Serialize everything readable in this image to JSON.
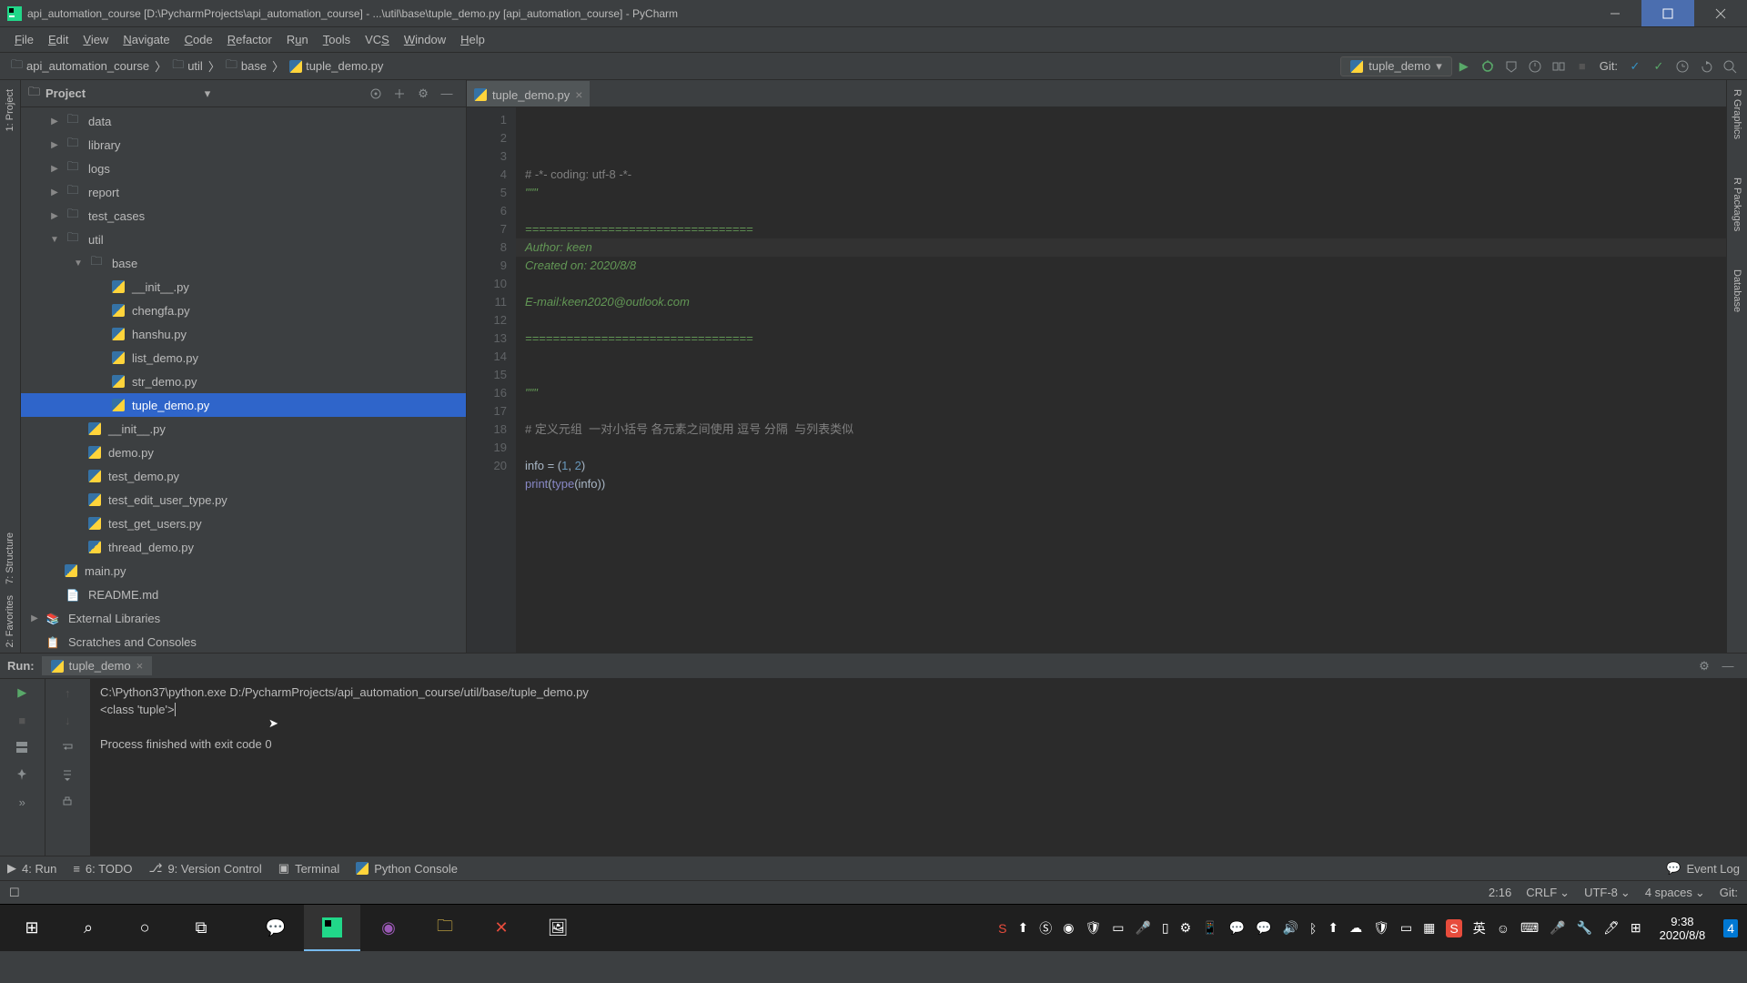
{
  "window": {
    "title": "api_automation_course [D:\\PycharmProjects\\api_automation_course] - ...\\util\\base\\tuple_demo.py [api_automation_course] - PyCharm"
  },
  "menu": [
    "File",
    "Edit",
    "View",
    "Navigate",
    "Code",
    "Refactor",
    "Run",
    "Tools",
    "VCS",
    "Window",
    "Help"
  ],
  "breadcrumbs": [
    "api_automation_course",
    "util",
    "base",
    "tuple_demo.py"
  ],
  "run_config": {
    "name": "tuple_demo"
  },
  "project_panel": {
    "title": "Project"
  },
  "tree": {
    "items": [
      {
        "label": "data",
        "indent": 1,
        "icon": "folder",
        "arrow": "right"
      },
      {
        "label": "library",
        "indent": 1,
        "icon": "folder",
        "arrow": "right"
      },
      {
        "label": "logs",
        "indent": 1,
        "icon": "folder",
        "arrow": "right"
      },
      {
        "label": "report",
        "indent": 1,
        "icon": "folder",
        "arrow": "right"
      },
      {
        "label": "test_cases",
        "indent": 1,
        "icon": "folder",
        "arrow": "right"
      },
      {
        "label": "util",
        "indent": 1,
        "icon": "folder",
        "arrow": "down"
      },
      {
        "label": "base",
        "indent": 2,
        "icon": "folder",
        "arrow": "down"
      },
      {
        "label": "__init__.py",
        "indent": 3,
        "icon": "py",
        "arrow": ""
      },
      {
        "label": "chengfa.py",
        "indent": 3,
        "icon": "py",
        "arrow": ""
      },
      {
        "label": "hanshu.py",
        "indent": 3,
        "icon": "py",
        "arrow": ""
      },
      {
        "label": "list_demo.py",
        "indent": 3,
        "icon": "py",
        "arrow": ""
      },
      {
        "label": "str_demo.py",
        "indent": 3,
        "icon": "py",
        "arrow": ""
      },
      {
        "label": "tuple_demo.py",
        "indent": 3,
        "icon": "py",
        "arrow": "",
        "selected": true
      },
      {
        "label": "__init__.py",
        "indent": 2,
        "icon": "py",
        "arrow": ""
      },
      {
        "label": "demo.py",
        "indent": 2,
        "icon": "py",
        "arrow": ""
      },
      {
        "label": "test_demo.py",
        "indent": 2,
        "icon": "py",
        "arrow": ""
      },
      {
        "label": "test_edit_user_type.py",
        "indent": 2,
        "icon": "py",
        "arrow": ""
      },
      {
        "label": "test_get_users.py",
        "indent": 2,
        "icon": "py",
        "arrow": ""
      },
      {
        "label": "thread_demo.py",
        "indent": 2,
        "icon": "py",
        "arrow": ""
      },
      {
        "label": "main.py",
        "indent": 1,
        "icon": "py",
        "arrow": ""
      },
      {
        "label": "README.md",
        "indent": 1,
        "icon": "md",
        "arrow": ""
      },
      {
        "label": "External Libraries",
        "indent": 0,
        "icon": "lib",
        "arrow": "right"
      },
      {
        "label": "Scratches and Consoles",
        "indent": 0,
        "icon": "scratch",
        "arrow": ""
      }
    ]
  },
  "editor": {
    "tab": "tuple_demo.py",
    "lines": 20,
    "code": {
      "l1": "# -*- coding: utf-8 -*-",
      "l2": "\"\"\"",
      "l3": "",
      "l4": "=================================",
      "l5": "Author: keen",
      "l6": "Created on: 2020/8/8",
      "l7": "",
      "l8": "E-mail:keen2020@outlook.com",
      "l9": "",
      "l10": "=================================",
      "l11": "",
      "l12": "",
      "l13": "\"\"\"",
      "l14": "",
      "l15": "# 定义元组  一对小括号 各元素之间使用 逗号 分隔  与列表类似",
      "l16": "",
      "l17_a": "info = (",
      "l17_b": "1",
      "l17_c": ", ",
      "l17_d": "2",
      "l17_e": ")",
      "l18_a": "print",
      "l18_b": "(",
      "l18_c": "type",
      "l18_d": "(info))"
    }
  },
  "run_panel": {
    "title": "Run:",
    "tab": "tuple_demo",
    "output_line1": "C:\\Python37\\python.exe D:/PycharmProjects/api_automation_course/util/base/tuple_demo.py",
    "output_line2": "<class 'tuple'>",
    "output_line3": "",
    "output_line4": "Process finished with exit code 0"
  },
  "bottom_tabs": {
    "run": "4: Run",
    "todo": "6: TODO",
    "vcs": "9: Version Control",
    "terminal": "Terminal",
    "console": "Python Console",
    "event": "Event Log"
  },
  "status": {
    "pos": "2:16",
    "eol": "CRLF",
    "enc": "UTF-8",
    "indent": "4 spaces",
    "git": "Git:"
  },
  "side": {
    "project": "1: Project",
    "structure": "7: Structure",
    "fav": "2: Favorites"
  },
  "right_side": {
    "graphics": "R Graphics",
    "packages": "R Packages",
    "database": "Database"
  },
  "clock": {
    "time": "9:38",
    "date": "2020/8/8"
  },
  "ime": {
    "lang": "英"
  },
  "navbar_git": "Git:"
}
